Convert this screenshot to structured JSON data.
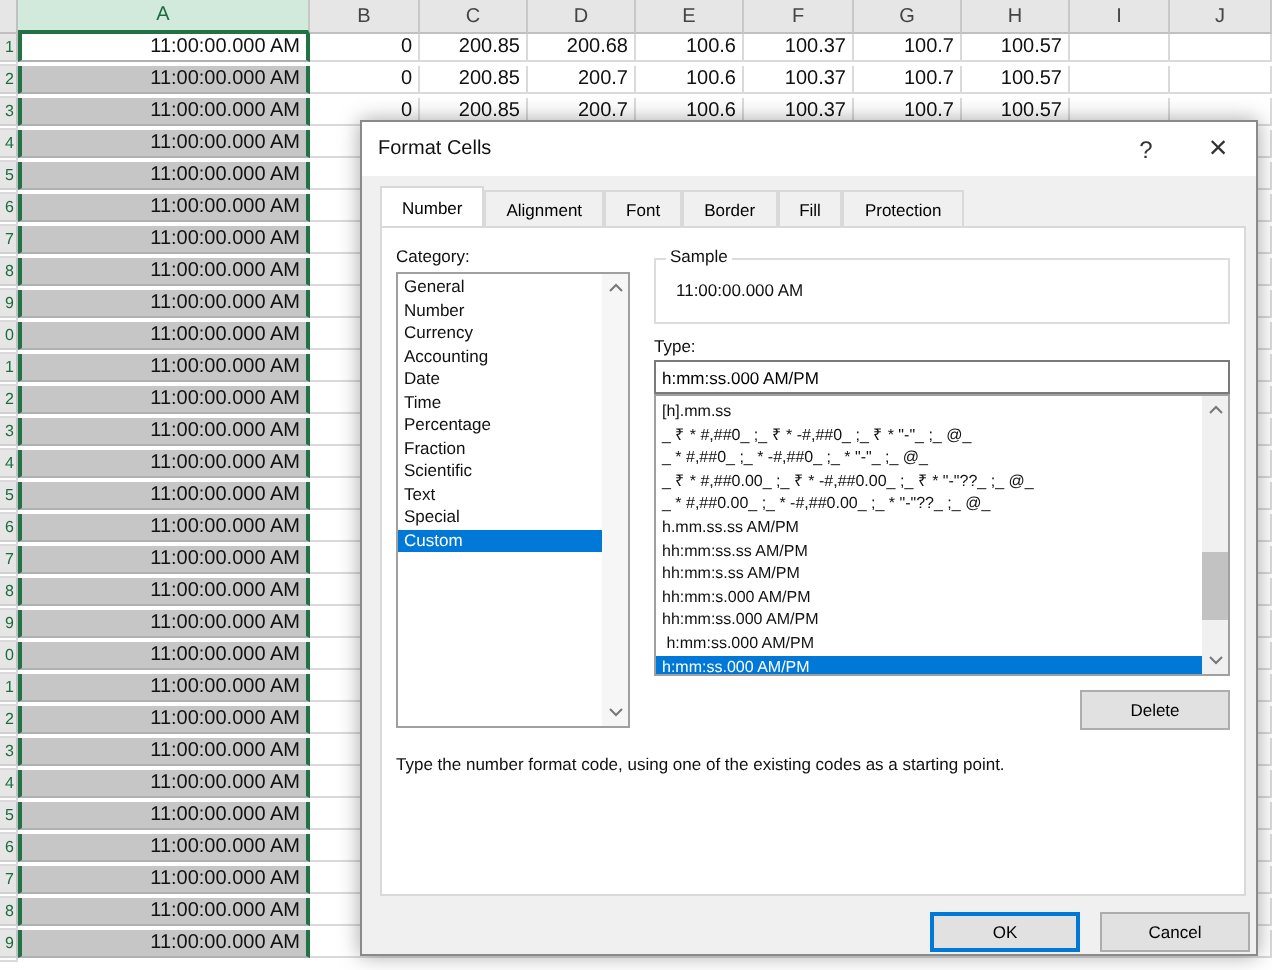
{
  "sheet": {
    "columns": [
      {
        "label": "A",
        "selected": true
      },
      {
        "label": "B",
        "selected": false
      },
      {
        "label": "C",
        "selected": false
      },
      {
        "label": "D",
        "selected": false
      },
      {
        "label": "E",
        "selected": false
      },
      {
        "label": "F",
        "selected": false
      },
      {
        "label": "G",
        "selected": false
      },
      {
        "label": "H",
        "selected": false
      },
      {
        "label": "I",
        "selected": false
      },
      {
        "label": "J",
        "selected": false
      }
    ],
    "rows": [
      {
        "header": "1",
        "active": true,
        "cells": [
          "11:00:00.000 AM",
          "0",
          "200.85",
          "200.68",
          "100.6",
          "100.37",
          "100.7",
          "100.57"
        ]
      },
      {
        "header": "2",
        "active": false,
        "cells": [
          "11:00:00.000 AM",
          "0",
          "200.85",
          "200.7",
          "100.6",
          "100.37",
          "100.7",
          "100.57"
        ]
      },
      {
        "header": "3",
        "active": false,
        "cells": [
          "11:00:00.000 AM",
          "0",
          "200.85",
          "200.7",
          "100.6",
          "100.37",
          "100.7",
          "100.57"
        ]
      },
      {
        "header": "4",
        "active": false,
        "cells": [
          "11:00:00.000 AM"
        ]
      },
      {
        "header": "5",
        "active": false,
        "cells": [
          "11:00:00.000 AM"
        ]
      },
      {
        "header": "6",
        "active": false,
        "cells": [
          "11:00:00.000 AM"
        ]
      },
      {
        "header": "7",
        "active": false,
        "cells": [
          "11:00:00.000 AM"
        ]
      },
      {
        "header": "8",
        "active": false,
        "cells": [
          "11:00:00.000 AM"
        ]
      },
      {
        "header": "9",
        "active": false,
        "cells": [
          "11:00:00.000 AM"
        ]
      },
      {
        "header": "0",
        "active": false,
        "cells": [
          "11:00:00.000 AM"
        ]
      },
      {
        "header": "1",
        "active": false,
        "cells": [
          "11:00:00.000 AM"
        ]
      },
      {
        "header": "2",
        "active": false,
        "cells": [
          "11:00:00.000 AM"
        ]
      },
      {
        "header": "3",
        "active": false,
        "cells": [
          "11:00:00.000 AM"
        ]
      },
      {
        "header": "4",
        "active": false,
        "cells": [
          "11:00:00.000 AM"
        ]
      },
      {
        "header": "5",
        "active": false,
        "cells": [
          "11:00:00.000 AM"
        ]
      },
      {
        "header": "6",
        "active": false,
        "cells": [
          "11:00:00.000 AM"
        ]
      },
      {
        "header": "7",
        "active": false,
        "cells": [
          "11:00:00.000 AM"
        ]
      },
      {
        "header": "8",
        "active": false,
        "cells": [
          "11:00:00.000 AM"
        ]
      },
      {
        "header": "9",
        "active": false,
        "cells": [
          "11:00:00.000 AM"
        ]
      },
      {
        "header": "0",
        "active": false,
        "cells": [
          "11:00:00.000 AM"
        ]
      },
      {
        "header": "1",
        "active": false,
        "cells": [
          "11:00:00.000 AM"
        ]
      },
      {
        "header": "2",
        "active": false,
        "cells": [
          "11:00:00.000 AM"
        ]
      },
      {
        "header": "3",
        "active": false,
        "cells": [
          "11:00:00.000 AM"
        ]
      },
      {
        "header": "4",
        "active": false,
        "cells": [
          "11:00:00.000 AM"
        ]
      },
      {
        "header": "5",
        "active": false,
        "cells": [
          "11:00:00.000 AM"
        ]
      },
      {
        "header": "6",
        "active": false,
        "cells": [
          "11:00:00.000 AM"
        ]
      },
      {
        "header": "7",
        "active": false,
        "cells": [
          "11:00:00.000 AM"
        ]
      },
      {
        "header": "8",
        "active": false,
        "cells": [
          "11:00:00.000 AM"
        ]
      },
      {
        "header": "9",
        "active": false,
        "cells": [
          "11:00:00.000 AM"
        ]
      }
    ]
  },
  "dialog": {
    "title": "Format Cells",
    "help": "?",
    "close": "×",
    "tabs": [
      {
        "label": "Number",
        "selected": true
      },
      {
        "label": "Alignment",
        "selected": false
      },
      {
        "label": "Font",
        "selected": false
      },
      {
        "label": "Border",
        "selected": false
      },
      {
        "label": "Fill",
        "selected": false
      },
      {
        "label": "Protection",
        "selected": false
      }
    ],
    "category_label": "Category:",
    "categories": [
      {
        "label": "General",
        "selected": false
      },
      {
        "label": "Number",
        "selected": false
      },
      {
        "label": "Currency",
        "selected": false
      },
      {
        "label": "Accounting",
        "selected": false
      },
      {
        "label": "Date",
        "selected": false
      },
      {
        "label": "Time",
        "selected": false
      },
      {
        "label": "Percentage",
        "selected": false
      },
      {
        "label": "Fraction",
        "selected": false
      },
      {
        "label": "Scientific",
        "selected": false
      },
      {
        "label": "Text",
        "selected": false
      },
      {
        "label": "Special",
        "selected": false
      },
      {
        "label": "Custom",
        "selected": true
      }
    ],
    "sample_label": "Sample",
    "sample_value": "11:00:00.000 AM",
    "type_label": "Type:",
    "type_value": "h:mm:ss.000 AM/PM",
    "formats": [
      {
        "label": "[h].mm.ss",
        "selected": false
      },
      {
        "label": "_ ₹ * #,##0_ ;_ ₹ * -#,##0_ ;_ ₹ * \"-\"_ ;_ @_",
        "selected": false
      },
      {
        "label": "_ * #,##0_ ;_ * -#,##0_ ;_ * \"-\"_ ;_ @_",
        "selected": false
      },
      {
        "label": "_ ₹ * #,##0.00_ ;_ ₹ * -#,##0.00_ ;_ ₹ * \"-\"??_ ;_ @_",
        "selected": false
      },
      {
        "label": "_ * #,##0.00_ ;_ * -#,##0.00_ ;_ * \"-\"??_ ;_ @_",
        "selected": false
      },
      {
        "label": "h.mm.ss.ss AM/PM",
        "selected": false
      },
      {
        "label": "hh:mm:ss.ss AM/PM",
        "selected": false
      },
      {
        "label": "hh:mm:s.ss AM/PM",
        "selected": false
      },
      {
        "label": "hh:mm:s.000 AM/PM",
        "selected": false
      },
      {
        "label": "hh:mm:ss.000 AM/PM",
        "selected": false
      },
      {
        "label": " h:mm:ss.000 AM/PM",
        "selected": false
      },
      {
        "label": "h:mm:ss.000 AM/PM",
        "selected": true
      }
    ],
    "delete_button": "Delete",
    "description": "Type the number format code, using one of the existing codes as a starting point.",
    "buttons": [
      {
        "label": "OK",
        "default": true
      },
      {
        "label": "Cancel",
        "default": false
      }
    ]
  }
}
